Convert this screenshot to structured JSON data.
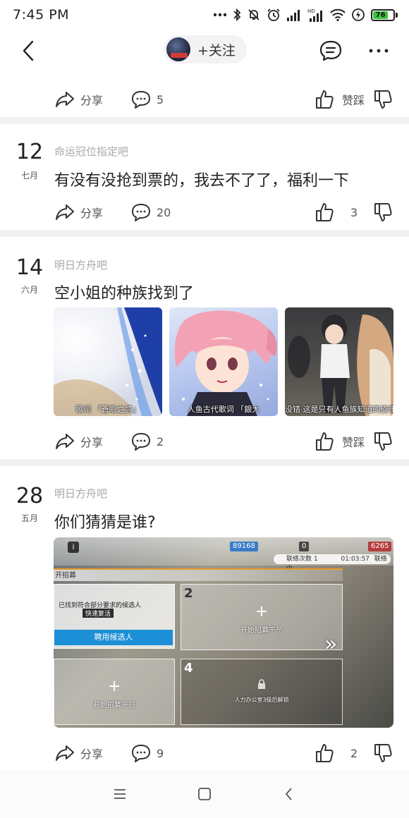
{
  "status_bar": {
    "time": "7:45 PM",
    "battery_level": "76"
  },
  "nav": {
    "follow_label": "+关注"
  },
  "actions": {
    "share_label": "分享",
    "like_dislike_label": "赞踩"
  },
  "top_row": {
    "comment_count": "5"
  },
  "posts": [
    {
      "day": "12",
      "month": "七月",
      "forum": "命运冠位指定吧",
      "title": "有没有没抢到票的，我去不了了，福利一下",
      "comment_count": "20",
      "like_count": "3"
    },
    {
      "day": "14",
      "month": "六月",
      "forum": "明日方舟吧",
      "title": "空小姐的种族找到了",
      "images": [
        {
          "caption": "歌词 「蒼眼之詩」"
        },
        {
          "caption": "人鱼古代歌词 「銀大"
        },
        {
          "caption": "没错 这是只有人鱼族知道的旋律"
        }
      ],
      "comment_count": "2"
    },
    {
      "day": "28",
      "month": "五月",
      "forum": "明日方舟吧",
      "title": "你们猜猜是谁?",
      "game": {
        "stat1": "89168",
        "stat2": "0",
        "stat3": "6265",
        "timer_label": "联络次数 1",
        "timer": "01:03:57",
        "timer_status": "联络中",
        "section_label": "开招募",
        "note": "已找到符合部分要求的候选人",
        "tag": "快速复活",
        "hire_button": "聘用候选人",
        "slot2_num": "2",
        "slot4_num": "4",
        "start_label": "开始招募干员",
        "locked_label": "人力办公室3级后解锁"
      },
      "comment_count": "9",
      "like_count": "2"
    }
  ],
  "colors": {
    "divider": "#f2f2f4",
    "muted_text": "#a8a8a8",
    "battery": "#3ec23e"
  }
}
